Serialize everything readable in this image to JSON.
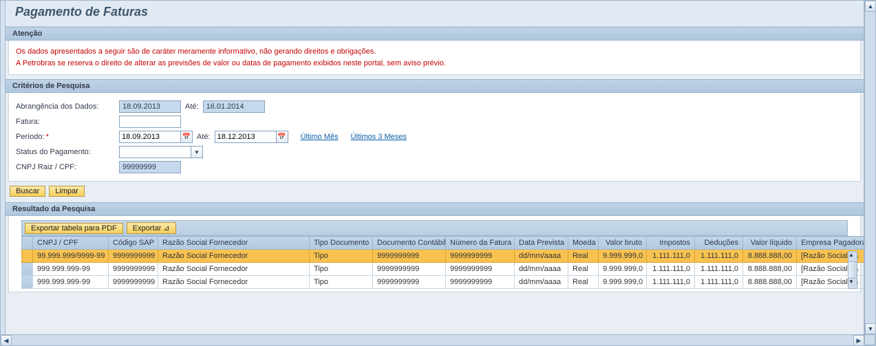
{
  "page": {
    "title": "Pagamento de Faturas"
  },
  "attention": {
    "header": "Atenção",
    "line1": "Os dados apresentados a seguir são de caráter meramente informativo, não gerando direitos e obrigações.",
    "line2": "A Petrobras se reserva o direito de alterar as previsões de valor ou datas de pagamento exibidos neste portal, sem aviso prévio."
  },
  "criteria": {
    "header": "Critérios de Pesquisa",
    "labels": {
      "abrangencia": "Abrangência dos Dados:",
      "fatura": "Fatura:",
      "periodo": "Período:",
      "status": "Status do Pagamento:",
      "cnpj": "CNPJ Raiz / CPF:",
      "ate": "Até:"
    },
    "values": {
      "abr_from": "18.09.2013",
      "abr_to": "16.01.2014",
      "fatura": "",
      "per_from": "18.09.2013",
      "per_to": "18.12.2013",
      "status": "",
      "cnpj": "99999999"
    },
    "links": {
      "ultimo_mes": "Último Mês",
      "ultimos_3": "Últimos 3 Meses"
    }
  },
  "actions": {
    "buscar": "Buscar",
    "limpar": "Limpar"
  },
  "results": {
    "header": "Resultado da Pesquisa",
    "toolbar": {
      "export_pdf": "Exportar tabela para PDF",
      "export": "Exportar ⊿"
    },
    "columns": [
      "CNPJ / CPF",
      "Código SAP",
      "Razão Social Fornecedor",
      "Tipo Documento",
      "Documento Contábil",
      "Número da Fatura",
      "Data Prevista",
      "Moeda",
      "Valor bruto",
      "Impostos",
      "Deduções",
      "Valor líquido",
      "Empresa Pagadora"
    ],
    "rows": [
      {
        "sel": true,
        "cnpj": "99.999.999/9999-99",
        "sap": "9999999999",
        "razao": "Razão Social Fornecedor",
        "tipo": "Tipo",
        "doc": "9999999999",
        "num": "9999999999",
        "data": "dd/mm/aaaa",
        "moeda": "Real",
        "bruto": "9.999.999,0",
        "imp": "1.111.111,0",
        "ded": "1.111.111,0",
        "liq": "8.888.888,00",
        "emp": "[Razão Social da"
      },
      {
        "sel": false,
        "cnpj": "999.999.999-99",
        "sap": "9999999999",
        "razao": "Razão Social Fornecedor",
        "tipo": "Tipo",
        "doc": "9999999999",
        "num": "9999999999",
        "data": "dd/mm/aaaa",
        "moeda": "Real",
        "bruto": "9.999.999,0",
        "imp": "1.111.111,0",
        "ded": "1.111.111,0",
        "liq": "8.888.888,00",
        "emp": "[Razão Social da"
      },
      {
        "sel": false,
        "cnpj": "999.999.999-99",
        "sap": "9999999999",
        "razao": "Razão Social Fornecedor",
        "tipo": "Tipo",
        "doc": "9999999999",
        "num": "9999999999",
        "data": "dd/mm/aaaa",
        "moeda": "Real",
        "bruto": "9.999.999,0",
        "imp": "1.111.111,0",
        "ded": "1.111.111,0",
        "liq": "8.888.888,00",
        "emp": "[Razão Social da"
      }
    ]
  }
}
